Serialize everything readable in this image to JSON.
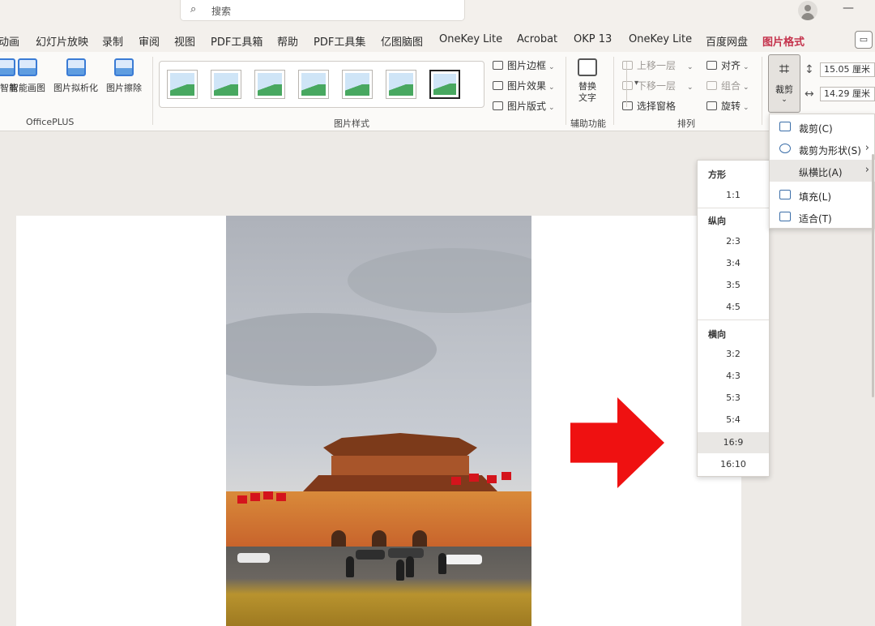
{
  "search": {
    "placeholder": "搜索"
  },
  "tabs": [
    "动画",
    "幻灯片放映",
    "录制",
    "审阅",
    "视图",
    "PDF工具箱",
    "帮助",
    "PDF工具集",
    "亿图脑图",
    "OneKey Lite",
    "Acrobat",
    "OKP 13",
    "OneKey Lite",
    "百度网盘",
    "图片格式"
  ],
  "active_tab": "图片格式",
  "ribbon": {
    "officeplus": {
      "label": "OfficePLUS",
      "buttons": [
        "图片智能",
        "智能画图",
        "图片拟析化",
        "图片擦除"
      ]
    },
    "picture_styles": {
      "label": "图片样式",
      "options": [
        "图片边框",
        "图片效果",
        "图片版式"
      ]
    },
    "accessibility": {
      "label": "辅助功能",
      "button": "替换\n文字"
    },
    "arrange": {
      "label": "排列",
      "buttons": [
        "上移一层",
        "下移一层",
        "选择窗格",
        "对齐",
        "组合",
        "旋转"
      ]
    },
    "size": {
      "crop_label": "裁剪",
      "height": "15.05 厘米",
      "width": "14.29 厘米"
    }
  },
  "crop_menu": {
    "items": [
      {
        "label": "裁剪(C)",
        "icon": "crop-icon"
      },
      {
        "label": "裁剪为形状(S)",
        "icon": "shape-icon",
        "submenu": true
      },
      {
        "label": "纵横比(A)",
        "icon": "",
        "submenu": true
      },
      {
        "label": "填充(L)",
        "icon": "fill-icon"
      },
      {
        "label": "适合(T)",
        "icon": "fit-icon"
      }
    ]
  },
  "aspect_menu": {
    "square_title": "方形",
    "square": [
      "1:1"
    ],
    "portrait_title": "纵向",
    "portrait": [
      "2:3",
      "3:4",
      "3:5",
      "4:5"
    ],
    "landscape_title": "横向",
    "landscape": [
      "3:2",
      "4:3",
      "5:3",
      "5:4",
      "16:9",
      "16:10"
    ],
    "highlighted": "16:9"
  },
  "colors": {
    "accent": "#c4314b",
    "arrow": "#ef1111"
  }
}
